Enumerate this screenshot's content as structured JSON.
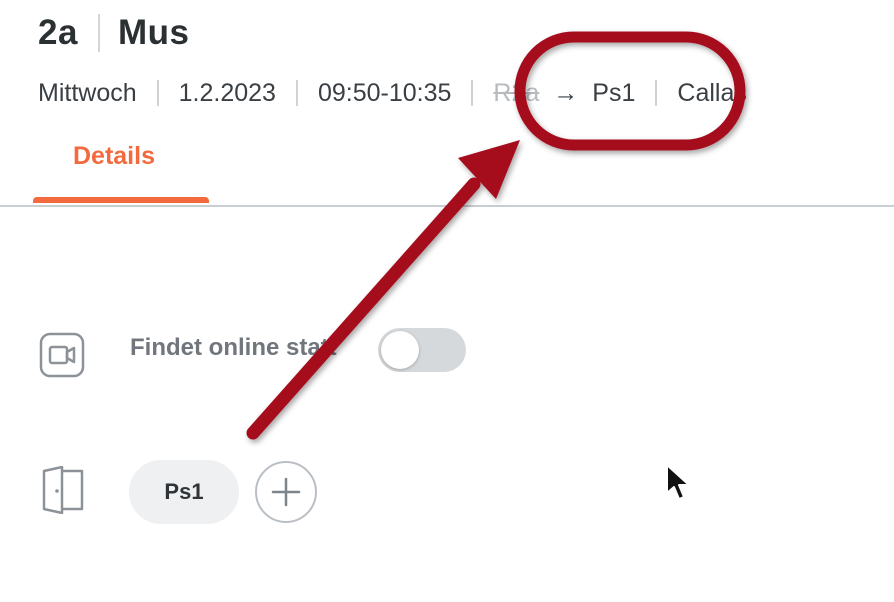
{
  "header": {
    "class_name": "2a",
    "subject": "Mus"
  },
  "meta": {
    "weekday": "Mittwoch",
    "date": "1.2.2023",
    "time": "09:50-10:35",
    "room_old": "R2a",
    "room_arrow": "→",
    "room_new": "Ps1",
    "teacher": "Callas"
  },
  "tabs": [
    {
      "label": "Details",
      "active": true
    }
  ],
  "online": {
    "label": "Findet online statt",
    "enabled": false,
    "icon": "video-camera-icon"
  },
  "room": {
    "icon": "door-icon",
    "chip_label": "Ps1",
    "add_icon": "plus-icon"
  },
  "colors": {
    "accent": "#f26a3d",
    "annotation": "#a6081e"
  }
}
